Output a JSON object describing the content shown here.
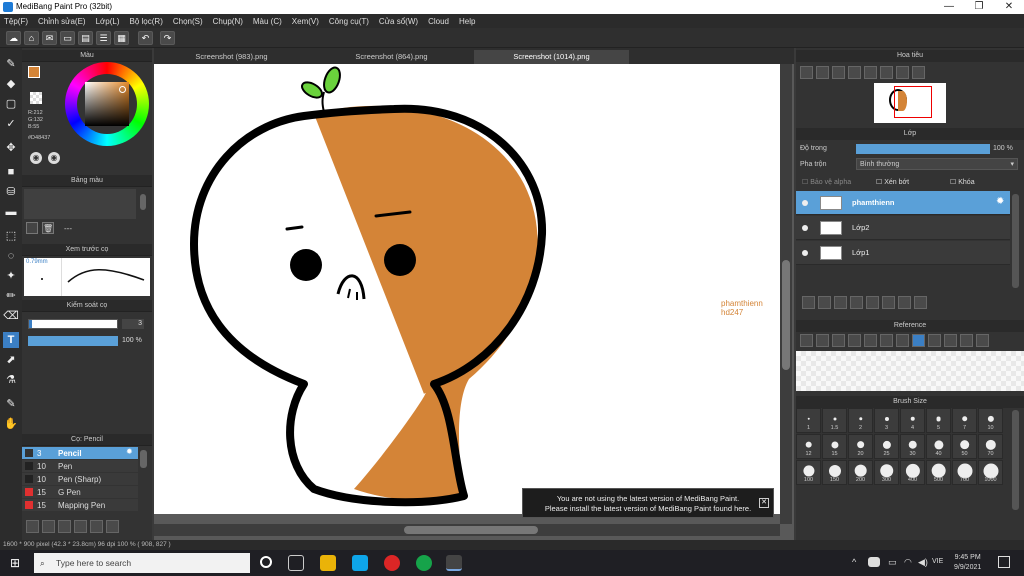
{
  "window": {
    "title": "MediBang Paint Pro (32bit)"
  },
  "menu": [
    "Tệp(F)",
    "Chỉnh sửa(E)",
    "Lớp(L)",
    "Bộ lọc(R)",
    "Chọn(S)",
    "Chụp(N)",
    "Màu (C)",
    "Xem(V)",
    "Công cụ(T)",
    "Cửa sổ(W)",
    "Cloud",
    "Help"
  ],
  "tabs": [
    "Screenshot (983).png",
    "Screenshot (864).png",
    "Screenshot (1014).png"
  ],
  "color_panel": {
    "title": "Màu",
    "rgb": [
      "R:212",
      "G:132",
      "B:55"
    ],
    "hex": "#D48437",
    "accent": "#D48437"
  },
  "palette_panel": {
    "title": "Bảng màu",
    "dash": "---"
  },
  "brush_preview": {
    "title": "Xem trước cọ",
    "size": "0.79mm"
  },
  "brush_control": {
    "title": "Kiểm soát cọ",
    "size_value": "3",
    "opacity_value": "100 %"
  },
  "brush_list": {
    "title": "Cọ: Pencil",
    "items": [
      {
        "size": "3",
        "name": "Pencil",
        "color": "#333333"
      },
      {
        "size": "10",
        "name": "Pen",
        "color": "#222222"
      },
      {
        "size": "10",
        "name": "Pen (Sharp)",
        "color": "#222222"
      },
      {
        "size": "15",
        "name": "G Pen",
        "color": "#e03030"
      },
      {
        "size": "15",
        "name": "Mapping Pen",
        "color": "#e03030"
      }
    ]
  },
  "canvas_text": {
    "line1": "phamthienn",
    "line2": "hd247"
  },
  "notice": {
    "line1": "You are not using the latest version of MediBang Paint.",
    "line2": "Please install the latest version of MediBang Paint found here."
  },
  "navigator": {
    "title": "Hoa tiêu"
  },
  "layer_panel": {
    "title": "Lớp",
    "opacity_label": "Độ trong",
    "opacity_value": "100 %",
    "blend_label": "Pha trộn",
    "blend_value": "Bình thường",
    "protect_alpha": "Bảo vệ alpha",
    "clipping": "Xén bớt",
    "lock": "Khóa",
    "layers": [
      "phamthienn",
      "Lớp2",
      "Lớp1"
    ]
  },
  "reference": {
    "title": "Reference"
  },
  "brush_size": {
    "title": "Brush Size",
    "sizes": [
      "1",
      "1.5",
      "2",
      "3",
      "4",
      "5",
      "7",
      "10",
      "12",
      "15",
      "20",
      "25",
      "30",
      "40",
      "50",
      "70",
      "100",
      "150",
      "200",
      "300",
      "400",
      "500",
      "700",
      "1000"
    ]
  },
  "status": {
    "text": "1600 * 900 pixel  (42.3 * 23.8cm)  96 dpi  100 %  ( 908, 827 )"
  },
  "taskbar": {
    "search_placeholder": "Type here to search",
    "lang": "VIE",
    "time": "9:45 PM",
    "date": "9/9/2021"
  }
}
